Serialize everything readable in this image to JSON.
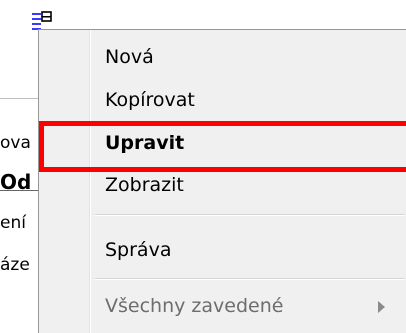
{
  "background_window": {
    "icon": "list-form-icon",
    "fragments": [
      "ova",
      "Od",
      "ení",
      "áze"
    ]
  },
  "context_menu": {
    "items": [
      {
        "label": "Nová",
        "bold": false,
        "disabled": false
      },
      {
        "label": "Kopírovat",
        "bold": false,
        "disabled": false
      },
      {
        "label": "Upravit",
        "bold": true,
        "disabled": false
      },
      {
        "label": "Zobrazit",
        "bold": false,
        "disabled": false
      },
      {
        "label": "Správa",
        "bold": false,
        "disabled": false
      },
      {
        "label": "Všechny zavedené",
        "bold": false,
        "disabled": true,
        "has_submenu": true
      }
    ]
  },
  "annotation": {
    "highlight_color": "#ff0000",
    "highlighted_item": "Upravit"
  }
}
